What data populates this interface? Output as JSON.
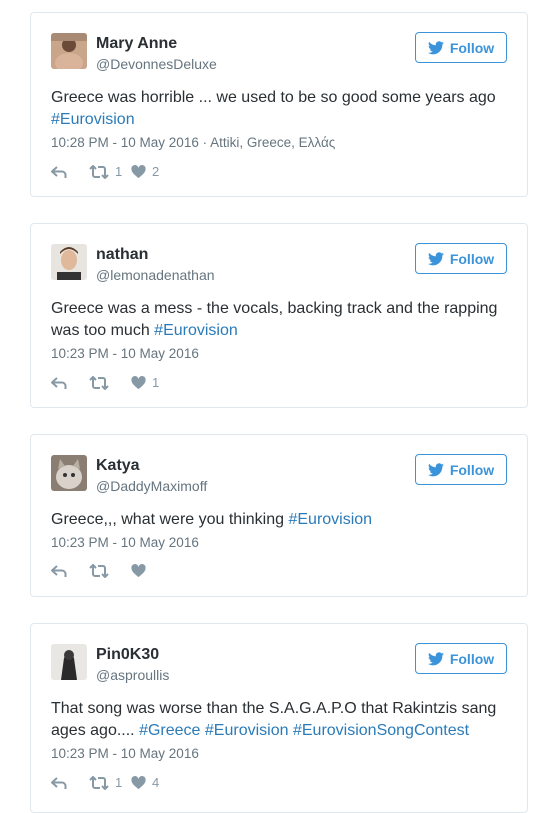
{
  "follow_label": "Follow",
  "tweets": [
    {
      "name": "Mary Anne",
      "handle": "@DevonnesDeluxe",
      "text_lines": [
        "Greece was horrible ... we used to be so good some years ago"
      ],
      "hashtags": [
        "#Eurovision"
      ],
      "timestamp": "10:28 PM - 10 May 2016",
      "location": "Attiki, Greece, Ελλάς",
      "retweets": "1",
      "likes": "2"
    },
    {
      "name": "nathan",
      "handle": "@lemonadenathan",
      "text": "Greece was a mess - the vocals, backing track and the rapping was too much",
      "hashtags": [
        "#Eurovision"
      ],
      "timestamp": "10:23 PM - 10 May 2016",
      "retweets": "",
      "likes": "1"
    },
    {
      "name": "Katya",
      "handle": "@DaddyMaximoff",
      "text": "Greece,,, what were you thinking",
      "hashtags": [
        "#Eurovision"
      ],
      "timestamp": "10:23 PM - 10 May 2016",
      "retweets": "",
      "likes": ""
    },
    {
      "name": "Pin0K30",
      "handle": "@asproullis",
      "text": "That song was worse than the S.A.G.A.P.O that Rakintzis sang ages ago....",
      "hashtags": [
        "#Greece",
        "#Eurovision",
        "#EurovisionSongContest"
      ],
      "timestamp": "10:23 PM - 10 May 2016",
      "retweets": "1",
      "likes": "4"
    }
  ],
  "colors": {
    "link": "#2b7bb9",
    "follow": "#3b94d9",
    "border": "#e1e8ed",
    "muted": "#66757f"
  },
  "icons": [
    "bird-icon",
    "reply-icon",
    "retweet-icon",
    "heart-icon"
  ]
}
